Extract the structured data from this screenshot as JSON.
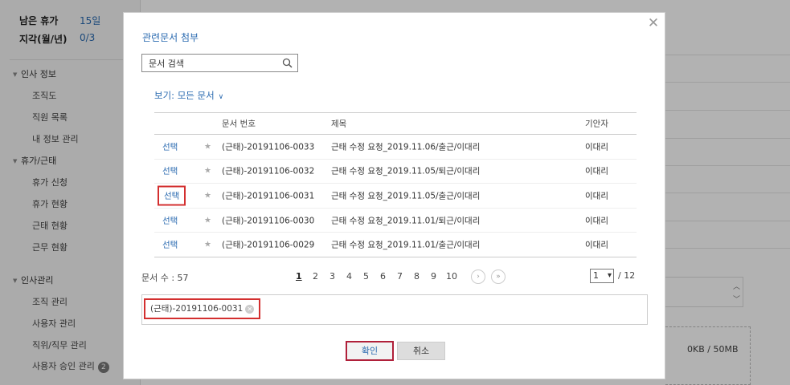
{
  "sidebar": {
    "leave_rows": [
      {
        "label": "남은 휴가",
        "value": "15일"
      },
      {
        "label": "지각(월/년)",
        "value": "0/3"
      }
    ],
    "sections": [
      {
        "label": "인사 정보",
        "items": [
          "조직도",
          "직원 목록",
          "내 정보 관리"
        ]
      },
      {
        "label": "휴가/근태",
        "items": [
          "휴가 신청",
          "휴가 현황",
          "근태 현황",
          "근무 현황"
        ]
      },
      {
        "label": "인사관리",
        "items": [
          "조직 관리",
          "사용자 관리",
          "직위/직무 관리",
          "사용자 승인 관리"
        ]
      }
    ],
    "approval_badge": "2"
  },
  "background": {
    "upload_size": "0KB / 50MB"
  },
  "modal": {
    "title": "관련문서 첨부",
    "search": {
      "placeholder": "문서 검색",
      "value": "문서 검색"
    },
    "view_filter": "보기: 모든 문서",
    "table": {
      "headers": {
        "number": "문서 번호",
        "title": "제목",
        "writer": "기안자"
      },
      "rows": [
        {
          "select": "선택",
          "number": "(근태)-20191106-0033",
          "title": "근태 수정 요청_2019.11.06/출근/이대리",
          "writer": "이대리"
        },
        {
          "select": "선택",
          "number": "(근태)-20191106-0032",
          "title": "근태 수정 요청_2019.11.05/퇴근/이대리",
          "writer": "이대리"
        },
        {
          "select": "선택",
          "number": "(근태)-20191106-0031",
          "title": "근태 수정 요청_2019.11.05/출근/이대리",
          "writer": "이대리"
        },
        {
          "select": "선택",
          "number": "(근태)-20191106-0030",
          "title": "근태 수정 요청_2019.11.01/퇴근/이대리",
          "writer": "이대리"
        },
        {
          "select": "선택",
          "number": "(근태)-20191106-0029",
          "title": "근태 수정 요청_2019.11.01/출근/이대리",
          "writer": "이대리"
        }
      ]
    },
    "doc_count": "문서 수 : 57",
    "pagination": {
      "pages": [
        "1",
        "2",
        "3",
        "4",
        "5",
        "6",
        "7",
        "8",
        "9",
        "10"
      ],
      "current": "1",
      "next": "›",
      "last": "»"
    },
    "page_select": {
      "value": "1",
      "total": "/ 12"
    },
    "attached_doc": "(근태)-20191106-0031",
    "buttons": {
      "confirm": "확인",
      "cancel": "취소"
    }
  }
}
